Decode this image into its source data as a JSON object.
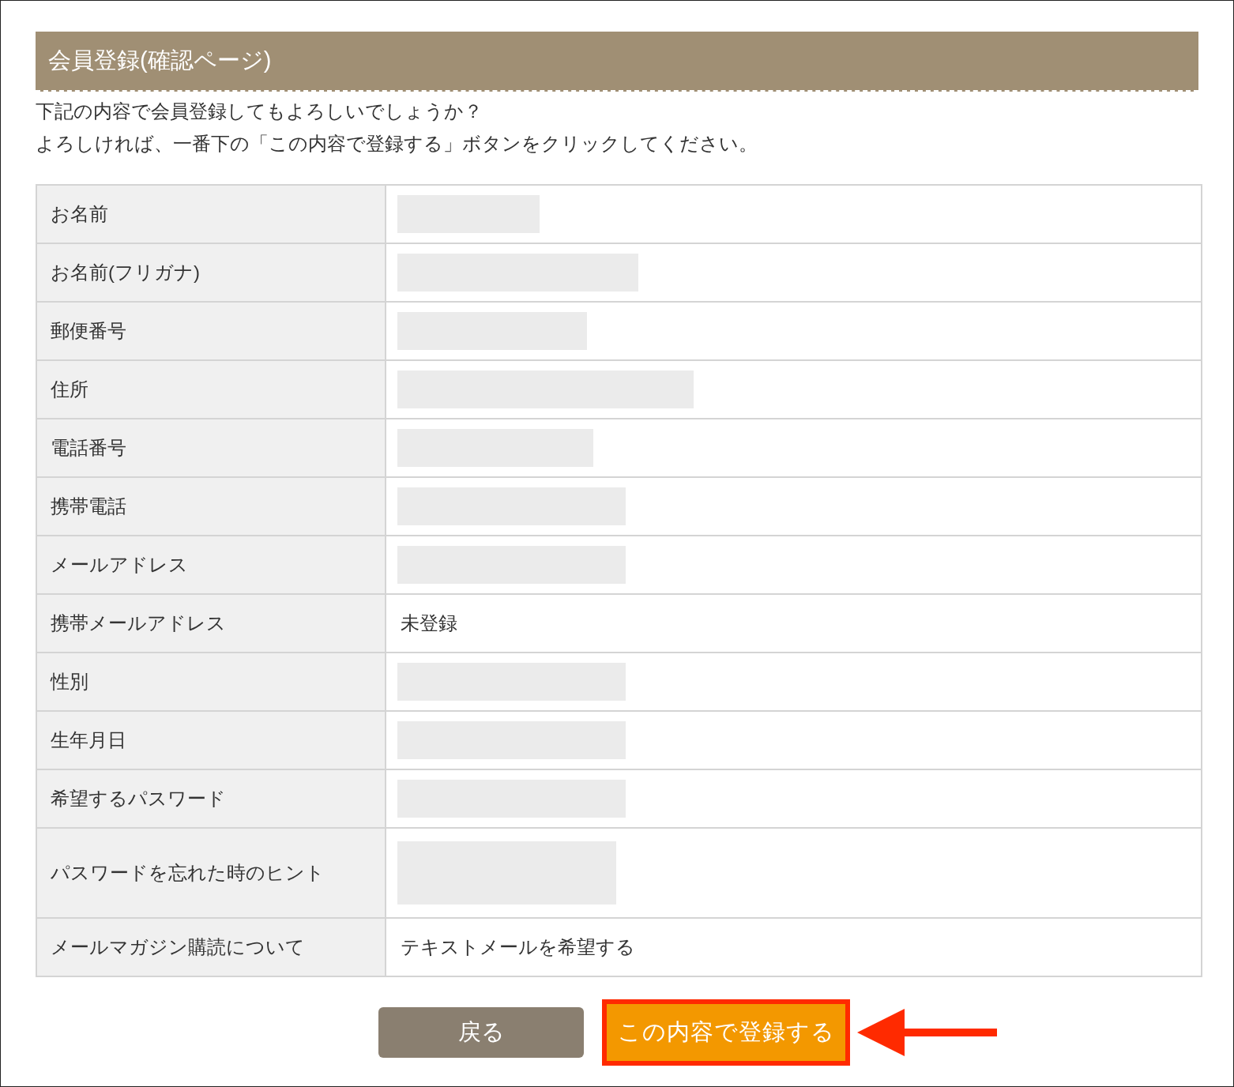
{
  "header": {
    "title": "会員登録(確認ページ)"
  },
  "intro": [
    "下記の内容で会員登録してもよろしいでしょうか？",
    "よろしければ、一番下の「この内容で登録する」ボタンをクリックしてください。"
  ],
  "rows": [
    {
      "label": "お名前",
      "kind": "masked"
    },
    {
      "label": "お名前(フリガナ)",
      "kind": "masked"
    },
    {
      "label": "郵便番号",
      "kind": "masked"
    },
    {
      "label": "住所",
      "kind": "masked"
    },
    {
      "label": "電話番号",
      "kind": "masked"
    },
    {
      "label": "携帯電話",
      "kind": "masked"
    },
    {
      "label": "メールアドレス",
      "kind": "masked"
    },
    {
      "label": "携帯メールアドレス",
      "kind": "text",
      "value": "未登録"
    },
    {
      "label": "性別",
      "kind": "masked"
    },
    {
      "label": "生年月日",
      "kind": "masked"
    },
    {
      "label": "希望するパスワード",
      "kind": "masked"
    },
    {
      "label": "パスワードを忘れた時のヒント",
      "kind": "masked"
    },
    {
      "label": "メールマガジン購読について",
      "kind": "text",
      "value": "テキストメールを希望する"
    }
  ],
  "buttons": {
    "back": "戻る",
    "submit": "この内容で登録する"
  }
}
